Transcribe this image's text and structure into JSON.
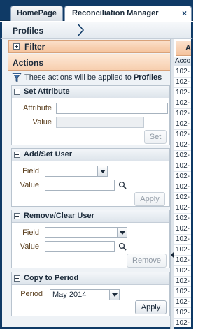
{
  "tabs": [
    {
      "label": "HomePage",
      "active": false
    },
    {
      "label": "Reconciliation Manager",
      "active": true,
      "close_glyph": "×"
    }
  ],
  "breadcrumb": {
    "label": "Profiles",
    "chevron_icon": "chevron-right-icon"
  },
  "filter": {
    "label": "Filter",
    "expanded": false
  },
  "actions": {
    "title": "Actions",
    "info_prefix": "These actions will be applied to ",
    "info_target": "Profiles",
    "set_attribute": {
      "title": "Set Attribute",
      "attribute_label": "Attribute",
      "attribute_value": "",
      "value_label": "Value",
      "value_value": "",
      "button": "Set"
    },
    "add_set_user": {
      "title": "Add/Set User",
      "field_label": "Field",
      "field_value": "",
      "value_label": "Value",
      "value_value": "",
      "button": "Apply"
    },
    "remove_clear_user": {
      "title": "Remove/Clear User",
      "field_label": "Field",
      "field_value": "",
      "value_label": "Value",
      "value_value": "",
      "button": "Remove"
    },
    "copy_to_period": {
      "title": "Copy to Period",
      "period_label": "Period",
      "period_value": "May 2014",
      "button": "Apply"
    }
  },
  "grid": {
    "tab_label": "Ac",
    "column_header": "Acco",
    "rows": [
      "102-",
      "102-",
      "102-",
      "102-",
      "102-",
      "102-",
      "102-",
      "102-",
      "102-",
      "102-",
      "102-",
      "102-",
      "102-",
      "102-",
      "102-",
      "102-",
      "102-",
      "102-",
      "102-",
      "102-",
      "102-",
      "102-",
      "102-",
      "102-",
      "102-"
    ]
  },
  "colors": {
    "brand_navy": "#0f3a66",
    "accent_orange": "#f5c39d"
  }
}
